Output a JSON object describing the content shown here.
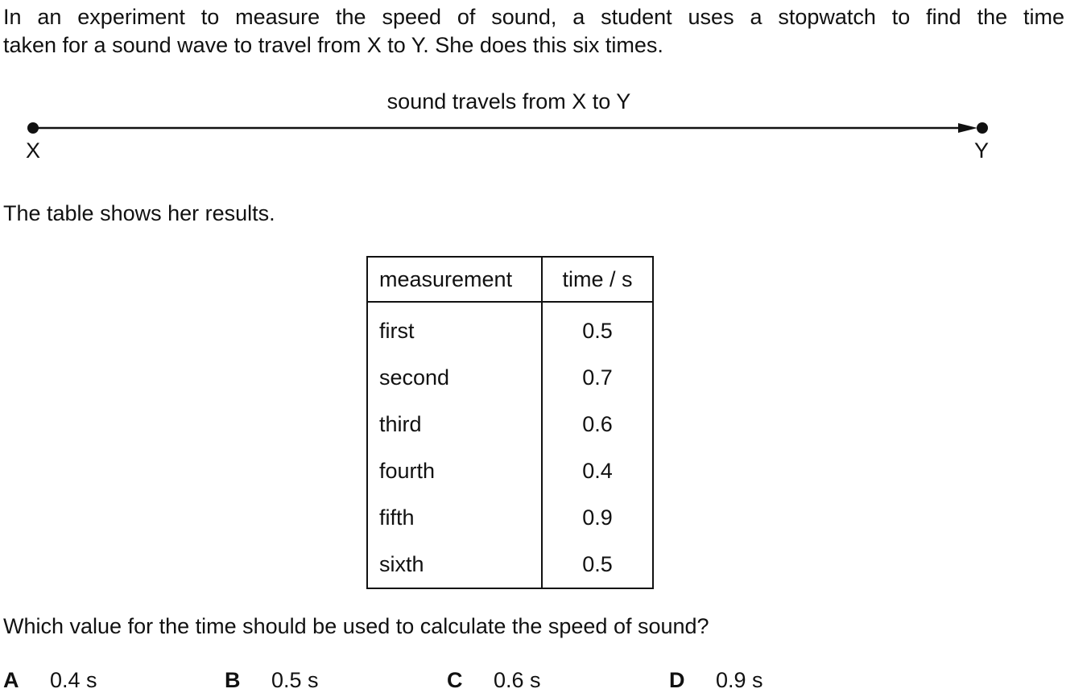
{
  "intro": {
    "line1": "In an experiment to measure the speed of sound, a student uses a stopwatch to find the time",
    "line2": "taken for a sound wave to travel from X to Y. She does this six times."
  },
  "diagram": {
    "caption": "sound travels from X to Y",
    "start_label": "X",
    "end_label": "Y"
  },
  "table_intro": "The table shows her results.",
  "table": {
    "headers": [
      "measurement",
      "time / s"
    ],
    "rows": [
      {
        "measurement": "first",
        "time": "0.5"
      },
      {
        "measurement": "second",
        "time": "0.7"
      },
      {
        "measurement": "third",
        "time": "0.6"
      },
      {
        "measurement": "fourth",
        "time": "0.4"
      },
      {
        "measurement": "fifth",
        "time": "0.9"
      },
      {
        "measurement": "sixth",
        "time": "0.5"
      }
    ]
  },
  "question": "Which value for the time should be used to calculate the speed of sound?",
  "options": [
    {
      "letter": "A",
      "value": "0.4 s"
    },
    {
      "letter": "B",
      "value": "0.5 s"
    },
    {
      "letter": "C",
      "value": "0.6 s"
    },
    {
      "letter": "D",
      "value": "0.9 s"
    }
  ]
}
